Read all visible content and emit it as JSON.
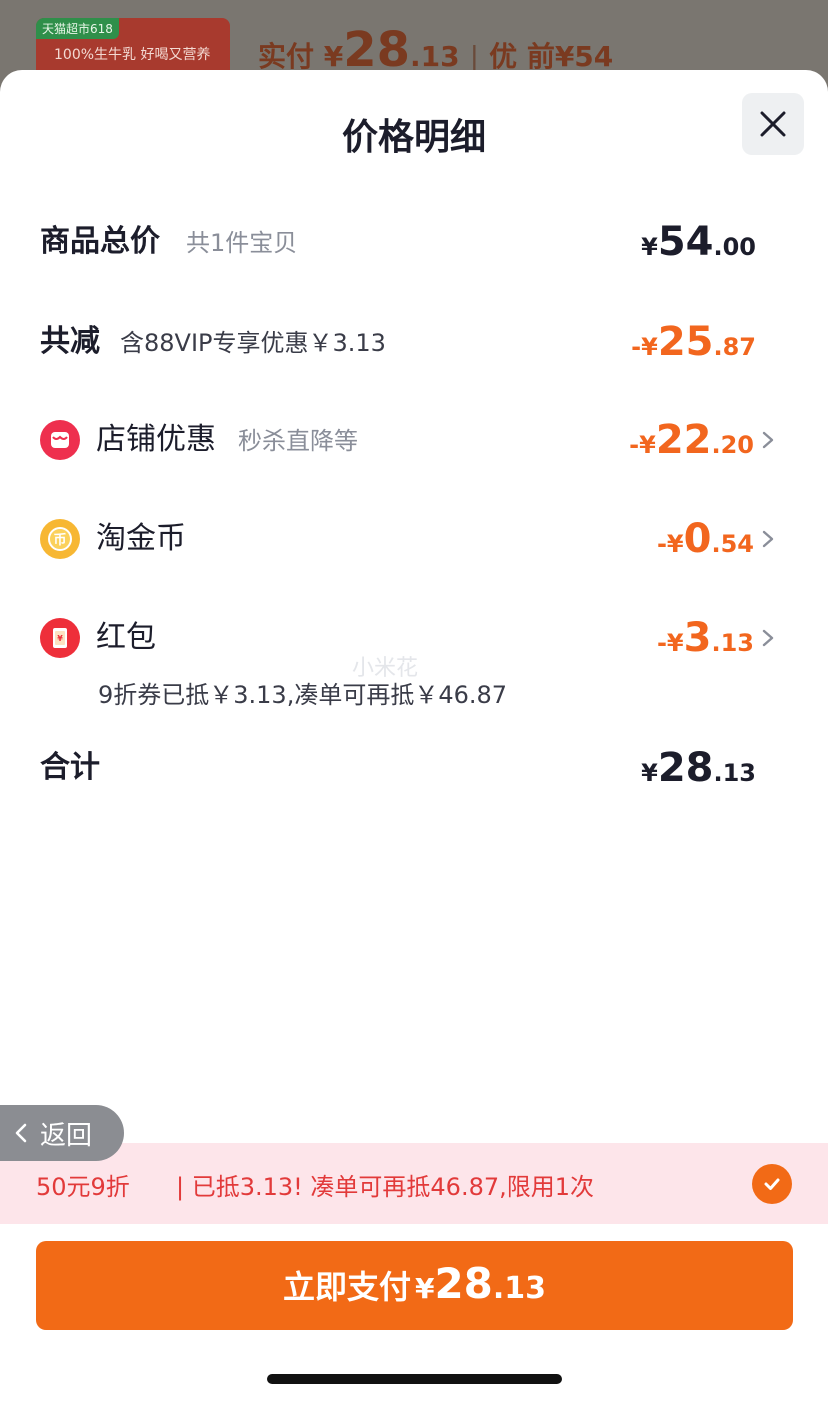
{
  "background": {
    "thumb_tag": "天猫超市618",
    "thumb_line": "100%生牛乳 好喝又营养",
    "price_prefix": "实付 ¥",
    "price_int": "28",
    "price_dec": ".13",
    "separator": "|",
    "tail": "优  前¥54"
  },
  "sheet": {
    "title": "价格明细",
    "close_icon": "close-icon"
  },
  "rows": {
    "total": {
      "label": "商品总价",
      "sub": "共1件宝贝",
      "cur": "¥",
      "int": "54",
      "dec": ".00"
    },
    "reduced": {
      "label": "共减",
      "sub": "含88VIP专享优惠￥3.13",
      "cur": "-¥",
      "int": "25",
      "dec": ".87"
    },
    "shop": {
      "label": "店铺优惠",
      "sub": "秒杀直降等",
      "cur": "-¥",
      "int": "22",
      "dec": ".20",
      "icon": "shop-icon"
    },
    "coins": {
      "label": "淘金币",
      "cur": "-¥",
      "int": "0",
      "dec": ".54",
      "icon": "coin-icon"
    },
    "redpacket": {
      "label": "红包",
      "cur": "-¥",
      "int": "3",
      "dec": ".13",
      "icon": "red-packet-icon",
      "note": "9折券已抵￥3.13,凑单可再抵￥46.87"
    },
    "sum": {
      "label": "合计",
      "cur": "¥",
      "int": "28",
      "dec": ".13"
    }
  },
  "watermark": "小米花",
  "back": {
    "label": "返回"
  },
  "promo": {
    "left": "50元9折",
    "text": "| 已抵3.13! 凑单可再抵46.87,限用1次"
  },
  "pay": {
    "label": "立即支付",
    "cur": "¥",
    "int": "28",
    "dec": ".13"
  },
  "colors": {
    "accent": "#f26a16",
    "promo_bg": "#fde5ea",
    "promo_text": "#e23a3a",
    "text": "#1c1d2b"
  }
}
